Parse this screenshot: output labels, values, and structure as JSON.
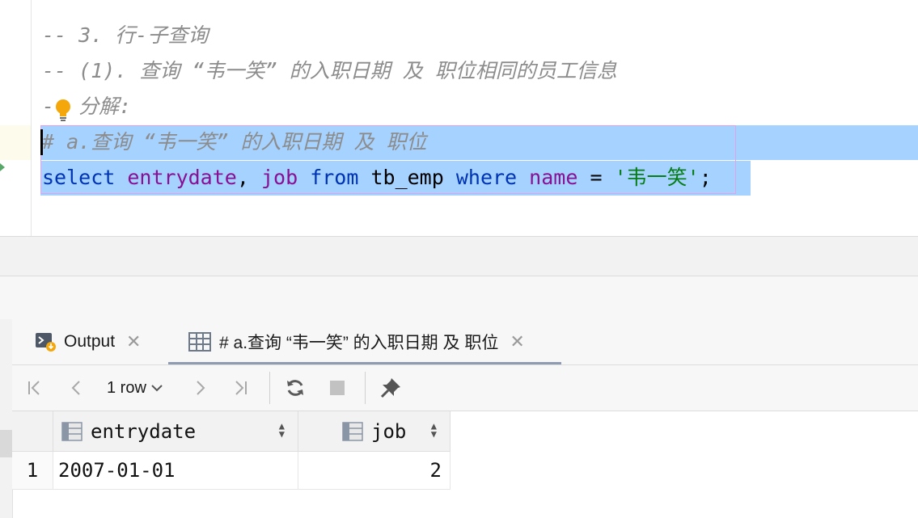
{
  "editor": {
    "comment1": "-- 3. 行-子查询",
    "comment2": "-- (1). 查询 “韦一笑” 的入职日期 及 职位相同的员工信息",
    "comment3_prefix": "-",
    "comment3_text": "分解:",
    "comment4": "# a.查询 “韦一笑” 的入职日期 及 职位",
    "sql": {
      "kw_select": "select",
      "col1": "entrydate",
      "comma": ",",
      "col2": "job",
      "kw_from": "from",
      "table": "tb_emp",
      "kw_where": "where",
      "col3": "name",
      "op": "=",
      "literal": "'韦一笑'",
      "semicolon": ";"
    }
  },
  "tabs": [
    {
      "label": "Output",
      "icon": "console-output-icon"
    },
    {
      "label": "# a.查询 “韦一笑” 的入职日期 及 职位",
      "icon": "table-grid-icon"
    }
  ],
  "toolbar": {
    "row_count": "1 row"
  },
  "result": {
    "columns": [
      "entrydate",
      "job"
    ],
    "rows": [
      {
        "index": "1",
        "entrydate": "2007-01-01",
        "job": "2"
      }
    ]
  },
  "colors": {
    "selection": "#a6d2ff",
    "keyword": "#0033b3",
    "identifier": "#871094",
    "string": "#067d17",
    "comment": "#8c8c8c"
  }
}
